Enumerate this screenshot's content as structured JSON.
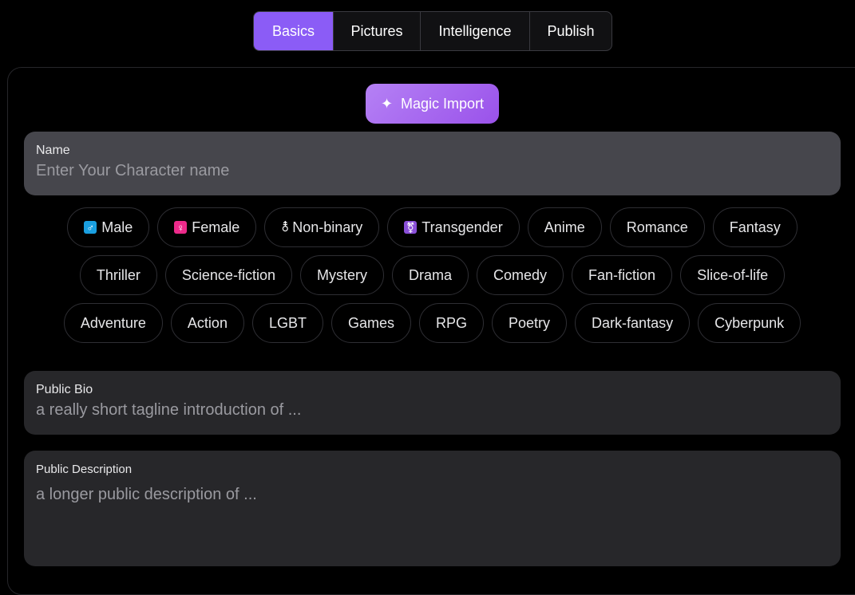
{
  "tabs": [
    {
      "label": "Basics",
      "active": true
    },
    {
      "label": "Pictures",
      "active": false
    },
    {
      "label": "Intelligence",
      "active": false
    },
    {
      "label": "Publish",
      "active": false
    }
  ],
  "magic_import": {
    "label": "Magic Import",
    "icon": "sparkles-icon"
  },
  "name_field": {
    "label": "Name",
    "placeholder": "Enter Your Character name"
  },
  "tags": {
    "row1": [
      {
        "label": "Male",
        "icon": "♂"
      },
      {
        "label": "Female",
        "icon": "♀"
      },
      {
        "label": "Non-binary",
        "icon": "⚨"
      },
      {
        "label": "Transgender",
        "icon": "⚧"
      },
      {
        "label": "Anime"
      },
      {
        "label": "Romance"
      },
      {
        "label": "Fantasy"
      }
    ],
    "row2": [
      {
        "label": "Thriller"
      },
      {
        "label": "Science-fiction"
      },
      {
        "label": "Mystery"
      },
      {
        "label": "Drama"
      },
      {
        "label": "Comedy"
      },
      {
        "label": "Fan-fiction"
      },
      {
        "label": "Slice-of-life"
      }
    ],
    "row3": [
      {
        "label": "Adventure"
      },
      {
        "label": "Action"
      },
      {
        "label": "LGBT"
      },
      {
        "label": "Games"
      },
      {
        "label": "RPG"
      },
      {
        "label": "Poetry"
      },
      {
        "label": "Dark-fantasy"
      },
      {
        "label": "Cyberpunk"
      }
    ]
  },
  "bio_field": {
    "label": "Public Bio",
    "placeholder": "a really short tagline introduction of ..."
  },
  "description_field": {
    "label": "Public Description",
    "placeholder": "a longer public description of ..."
  },
  "colors": {
    "accent": "#8b5cf6",
    "magic_gradient_start": "#b581f5",
    "magic_gradient_end": "#9a52ea"
  }
}
